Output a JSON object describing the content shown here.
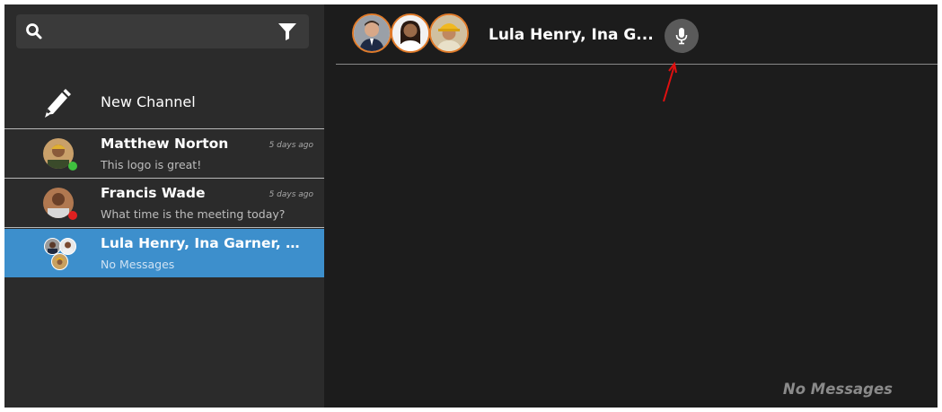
{
  "search": {
    "placeholder": "",
    "value": ""
  },
  "sidebar": {
    "new_channel_label": "New Channel",
    "conversations": [
      {
        "name": "Matthew Norton",
        "last_message": "This logo is great!",
        "time": "5 days ago",
        "status_color": "#3fbf3f"
      },
      {
        "name": "Francis Wade",
        "last_message": "What time is the meeting today?",
        "time": "5 days ago",
        "status_color": "#e02020"
      },
      {
        "name": "Lula Henry, Ina Garner, Osc...",
        "last_message": "No Messages",
        "time": "",
        "active": true
      }
    ]
  },
  "chat": {
    "title": "Lula Henry, Ina G...",
    "empty_text": "No Messages"
  },
  "colors": {
    "accent": "#3d8fcc",
    "sidebar_bg": "#2b2b2b",
    "main_bg": "#1c1c1c",
    "avatar_ring": "#e07b2a",
    "annotation_arrow": "#e01010"
  }
}
